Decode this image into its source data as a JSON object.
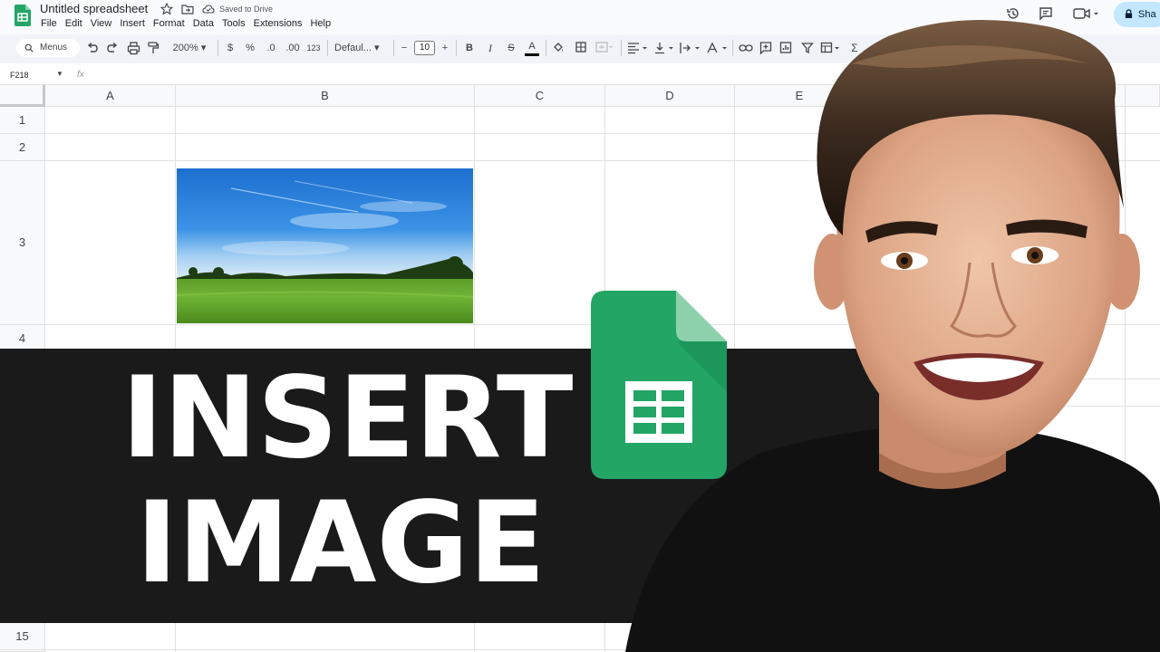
{
  "window": {
    "doc_title": "Untitled spreadsheet",
    "saved_status": "Saved to Drive",
    "share_label": "Sha"
  },
  "menu": [
    "File",
    "Edit",
    "View",
    "Insert",
    "Format",
    "Data",
    "Tools",
    "Extensions",
    "Help"
  ],
  "toolbar": {
    "search_label": "Menus",
    "zoom": "200%",
    "currency": "$",
    "percent": "%",
    "dec_decrease": ".0",
    "dec_increase": ".00",
    "number_format": "123",
    "font_name": "Defaul...",
    "font_size": "10",
    "bold": "B",
    "italic": "I",
    "strike": "S",
    "text_color": "A",
    "sum": "Σ"
  },
  "formula_bar": {
    "name_box": "F218",
    "fx_label": "fx"
  },
  "grid": {
    "columns": [
      "A",
      "B",
      "C",
      "D",
      "E"
    ],
    "rows": [
      "1",
      "2",
      "3",
      "4",
      "15"
    ]
  },
  "banner": {
    "line1": "INSERT",
    "line2": "IMAGE"
  },
  "colors": {
    "sheets_green": "#23a566",
    "sheets_dark_green": "#188038",
    "banner_bg": "#1a1a1a",
    "share_bg": "#c2e7ff"
  },
  "icons": [
    "sheets-logo-icon",
    "star-icon",
    "move-folder-icon",
    "cloud-saved-icon",
    "history-icon",
    "comment-icon",
    "meet-icon",
    "lock-icon",
    "search-icon",
    "undo-icon",
    "redo-icon",
    "print-icon",
    "paint-format-icon",
    "fill-color-icon",
    "borders-icon",
    "merge-icon",
    "align-icon",
    "valign-icon",
    "wrap-icon",
    "rotate-icon",
    "link-icon",
    "add-comment-icon",
    "chart-icon",
    "filter-icon",
    "views-icon",
    "function-icon"
  ]
}
